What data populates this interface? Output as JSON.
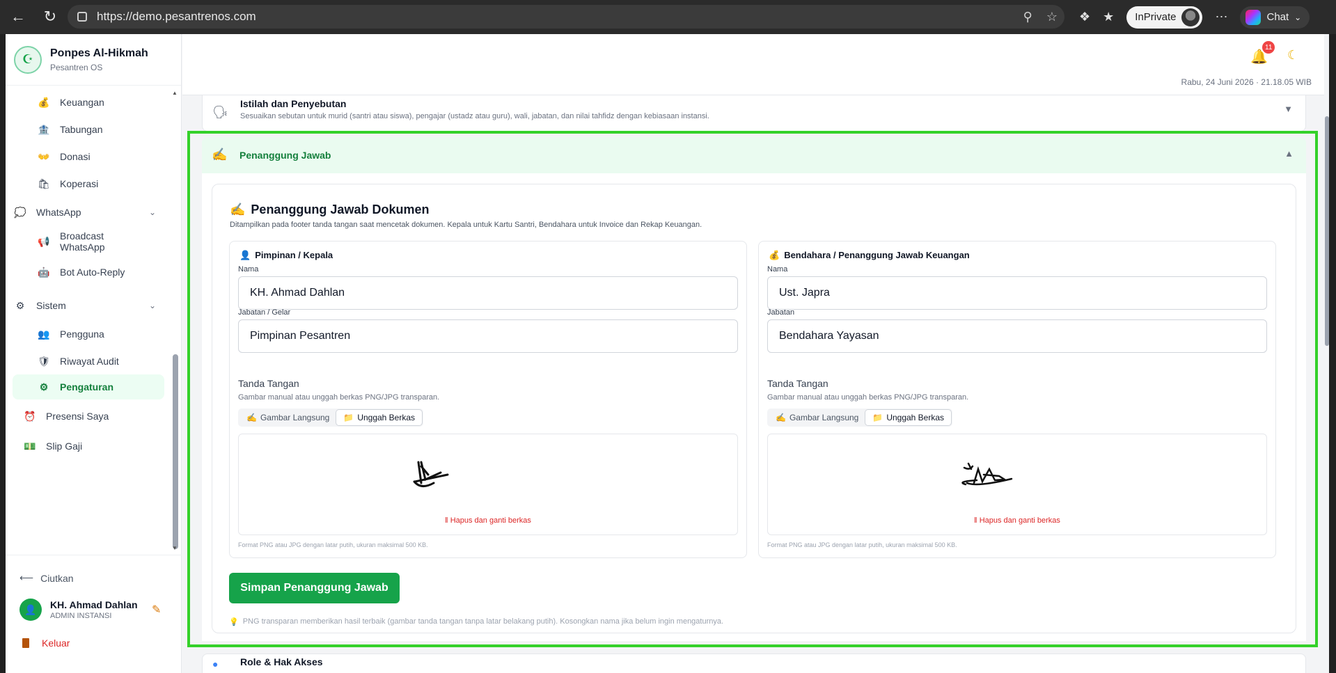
{
  "browser": {
    "url": "https://demo.pesantrenos.com",
    "inprivate_label": "InPrivate",
    "chat_label": "Chat"
  },
  "sidebar": {
    "brand_title": "Ponpes Al-Hikmah",
    "brand_sub": "Pesantren OS",
    "items": [
      {
        "label": "Keuangan",
        "icon": "money-bag-icon",
        "glyph": "💰",
        "type": "sub"
      },
      {
        "label": "Tabungan",
        "icon": "bank-icon",
        "glyph": "🏦",
        "type": "sub"
      },
      {
        "label": "Donasi",
        "icon": "hands-icon",
        "glyph": "👐",
        "type": "sub"
      },
      {
        "label": "Koperasi",
        "icon": "shopping-icon",
        "glyph": "🛍",
        "type": "sub"
      },
      {
        "label": "WhatsApp",
        "icon": "speech-bubble-icon",
        "glyph": "💭",
        "type": "group"
      },
      {
        "label": "Broadcast WhatsApp",
        "icon": "megaphone-icon",
        "glyph": "📢",
        "type": "sub"
      },
      {
        "label": "Bot Auto-Reply",
        "icon": "robot-icon",
        "glyph": "🤖",
        "type": "sub"
      },
      {
        "label": "Sistem",
        "icon": "gear-icon",
        "glyph": "⚙",
        "type": "group"
      },
      {
        "label": "Pengguna",
        "icon": "users-icon",
        "glyph": "👥",
        "type": "sub"
      },
      {
        "label": "Riwayat Audit",
        "icon": "shield-icon",
        "glyph": "🛡",
        "type": "sub"
      },
      {
        "label": "Pengaturan",
        "icon": "gear-icon",
        "glyph": "⚙",
        "type": "sub",
        "active": true
      },
      {
        "label": "Presensi Saya",
        "icon": "alarm-clock-icon",
        "glyph": "⏰",
        "type": "top"
      },
      {
        "label": "Slip Gaji",
        "icon": "money-icon",
        "glyph": "💵",
        "type": "top"
      }
    ],
    "collapse_label": "Ciutkan",
    "user_name": "KH. Ahmad Dahlan",
    "user_role": "ADMIN INSTANSI",
    "logout_label": "Keluar"
  },
  "topbar": {
    "notif_count": "11",
    "datetime": "Rabu, 24 Juni 2026 · 21.18.05 WIB"
  },
  "sections": {
    "istilah_title": "Istilah dan Penyebutan",
    "istilah_desc": "Sesuaikan sebutan untuk murid (santri atau siswa), pengajar (ustadz atau guru), wali, jabatan, dan nilai tahfidz dengan kebiasaan instansi.",
    "penanggung_title": "Penanggung Jawab",
    "role_title": "Role & Hak Akses"
  },
  "panel": {
    "title": "Penanggung Jawab Dokumen",
    "desc": "Ditampilkan pada footer tanda tangan saat mencetak dokumen. Kepala untuk Kartu Santri, Bendahara untuk Invoice dan Rekap Keuangan.",
    "left": {
      "heading": "Pimpinan / Kepala",
      "name_label": "Nama",
      "name_value": "KH. Ahmad Dahlan",
      "role_label": "Jabatan / Gelar",
      "role_value": "Pimpinan Pesantren"
    },
    "right": {
      "heading": "Bendahara / Penanggung Jawab Keuangan",
      "name_label": "Nama",
      "name_value": "Ust. Japra",
      "role_label": "Jabatan",
      "role_value": "Bendahara Yayasan"
    },
    "sig_title": "Tanda Tangan",
    "sig_desc": "Gambar manual atau unggah berkas PNG/JPG transparan.",
    "tab_draw": "Gambar Langsung",
    "tab_upload": "Unggah Berkas",
    "delete_label": "Hapus dan ganti berkas",
    "format_note": "Format PNG atau JPG dengan latar putih, ukuran maksimal 500 KB.",
    "save_label": "Simpan Penanggung Jawab",
    "tip": "PNG transparan memberikan hasil terbaik (gambar tanda tangan tanpa latar belakang putih). Kosongkan nama jika belum ingin mengaturnya."
  }
}
